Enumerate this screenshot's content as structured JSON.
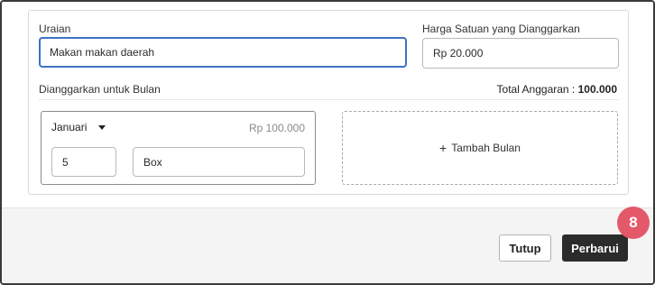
{
  "form": {
    "description_label": "Uraian",
    "description_value": "Makan makan daerah",
    "unit_price_label": "Harga Satuan yang Dianggarkan",
    "unit_price_value": "Rp 20.000",
    "budget_month_label": "Dianggarkan untuk Bulan",
    "total_label": "Total Anggaran :",
    "total_value": "100.000"
  },
  "month_entry": {
    "month": "Januari",
    "amount": "Rp 100.000",
    "quantity": "5",
    "unit": "Box"
  },
  "add_month": {
    "icon": "plus-icon",
    "label": "Tambah Bulan"
  },
  "actions": {
    "close_label": "Tutup",
    "update_label": "Perbarui"
  },
  "badge": {
    "step": "8"
  },
  "colors": {
    "focus_border": "#3b73c4",
    "primary_button": "#2b2b2b",
    "badge": "#e3596a"
  }
}
